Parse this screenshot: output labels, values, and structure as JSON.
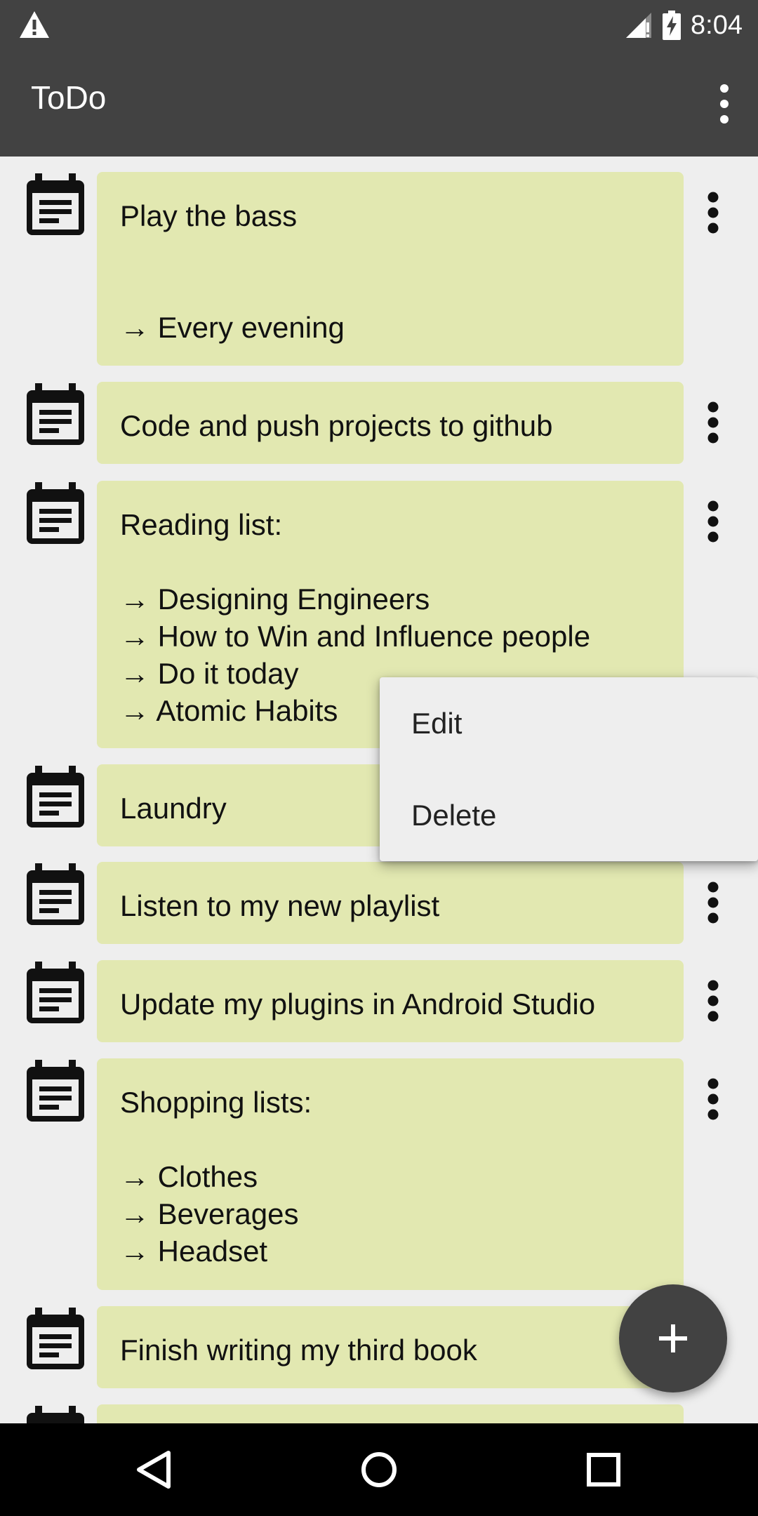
{
  "status_bar": {
    "time": "8:04",
    "icons": [
      "warning-icon",
      "signal-icon",
      "battery-charging-icon"
    ]
  },
  "app_bar": {
    "title": "ToDo",
    "menu_icon": "more-vert-icon"
  },
  "colors": {
    "bar": "#424242",
    "card": "#e2e8b1",
    "background": "#eeeeee",
    "fab": "#424242"
  },
  "todos": [
    {
      "lines": [
        "Play the bass",
        "",
        "",
        "→ Every evening"
      ]
    },
    {
      "lines": [
        "Code and push projects to github"
      ]
    },
    {
      "lines": [
        "Reading list:",
        "",
        "→ Designing Engineers",
        "→ How to Win and Influence people",
        "→ Do it today",
        "→ Atomic Habits"
      ]
    },
    {
      "lines": [
        "Laundry"
      ]
    },
    {
      "lines": [
        "Listen to my new playlist"
      ]
    },
    {
      "lines": [
        "Update my plugins in Android Studio"
      ]
    },
    {
      "lines": [
        "Shopping lists:",
        "",
        "→ Clothes",
        "→ Beverages",
        "→ Headset"
      ]
    },
    {
      "lines": [
        "Finish writing my third book"
      ]
    },
    {
      "lines": [
        ""
      ]
    }
  ],
  "popup_menu": {
    "items": [
      "Edit",
      "Delete"
    ]
  },
  "fab": {
    "icon": "plus-icon"
  },
  "nav_bar": {
    "icons": [
      "back-icon",
      "home-icon",
      "recents-icon"
    ]
  }
}
